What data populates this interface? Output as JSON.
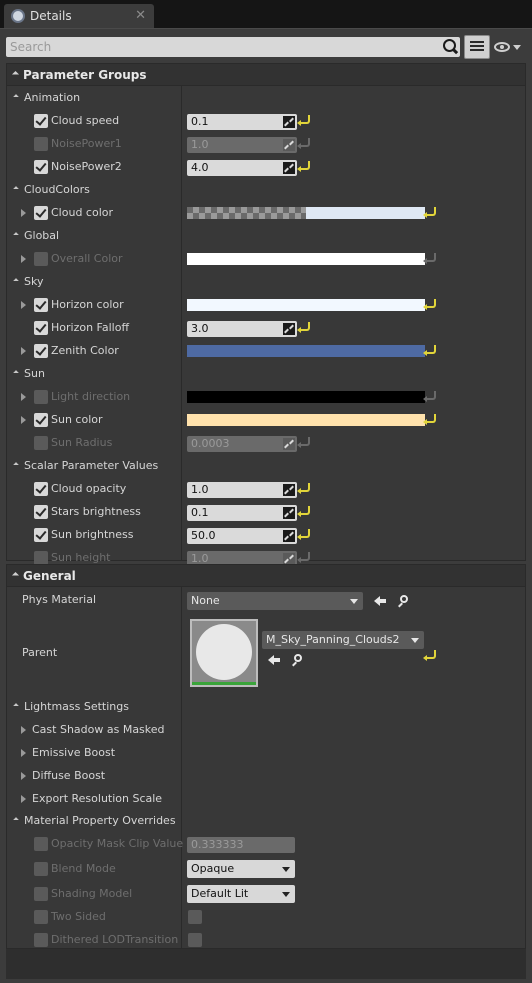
{
  "tab": {
    "title": "Details",
    "close": "✕"
  },
  "search": {
    "placeholder": "Search"
  },
  "parameter_groups": {
    "title": "Parameter Groups",
    "groups": [
      {
        "name": "Animation",
        "params": [
          {
            "label": "Cloud speed",
            "checked": true,
            "kind": "scalar",
            "value": "0.1"
          },
          {
            "label": "NoisePower1",
            "checked": false,
            "kind": "scalar",
            "value": "1.0"
          },
          {
            "label": "NoisePower2",
            "checked": true,
            "kind": "scalar",
            "value": "4.0"
          }
        ]
      },
      {
        "name": "CloudColors",
        "params": [
          {
            "label": "Cloud color",
            "checked": true,
            "kind": "color",
            "expand": true,
            "color": "#dfe8f4",
            "alpha_checker": true
          }
        ]
      },
      {
        "name": "Global",
        "params": [
          {
            "label": "Overall Color",
            "checked": false,
            "kind": "color",
            "expand": true,
            "color": "#ffffff"
          }
        ]
      },
      {
        "name": "Sky",
        "params": [
          {
            "label": "Horizon color",
            "checked": true,
            "kind": "color",
            "expand": true,
            "color": "#f2f8ff"
          },
          {
            "label": "Horizon Falloff",
            "checked": true,
            "kind": "scalar",
            "value": "3.0"
          },
          {
            "label": "Zenith Color",
            "checked": true,
            "kind": "color",
            "expand": true,
            "color": "#4e6aa3"
          }
        ]
      },
      {
        "name": "Sun",
        "params": [
          {
            "label": "Light direction",
            "checked": false,
            "kind": "color",
            "expand": true,
            "color": "#000000"
          },
          {
            "label": "Sun color",
            "checked": true,
            "kind": "color",
            "expand": true,
            "color": "#ffe2ac"
          },
          {
            "label": "Sun Radius",
            "checked": false,
            "kind": "scalar",
            "value": "0.0003"
          }
        ]
      },
      {
        "name": "Scalar Parameter Values",
        "params": [
          {
            "label": "Cloud opacity",
            "checked": true,
            "kind": "scalar",
            "value": "1.0"
          },
          {
            "label": "Stars brightness",
            "checked": true,
            "kind": "scalar",
            "value": "0.1"
          },
          {
            "label": "Sun brightness",
            "checked": true,
            "kind": "scalar",
            "value": "50.0"
          },
          {
            "label": "Sun height",
            "checked": false,
            "kind": "scalar",
            "value": "1.0"
          }
        ]
      }
    ]
  },
  "general": {
    "title": "General",
    "phys_material": {
      "label": "Phys Material",
      "value": "None"
    },
    "parent": {
      "label": "Parent",
      "value": "M_Sky_Panning_Clouds2"
    },
    "lightmass": {
      "title": "Lightmass Settings",
      "items": [
        "Cast Shadow as Masked",
        "Emissive Boost",
        "Diffuse Boost",
        "Export Resolution Scale"
      ]
    },
    "overrides": {
      "title": "Material Property Overrides",
      "opacity_mask": {
        "label": "Opacity Mask Clip Value",
        "value": "0.333333"
      },
      "blend_mode": {
        "label": "Blend Mode",
        "value": "Opaque"
      },
      "shading_model": {
        "label": "Shading Model",
        "value": "Default Lit"
      },
      "two_sided": {
        "label": "Two Sided"
      },
      "dithered": {
        "label": "Dithered LODTransition"
      }
    }
  }
}
